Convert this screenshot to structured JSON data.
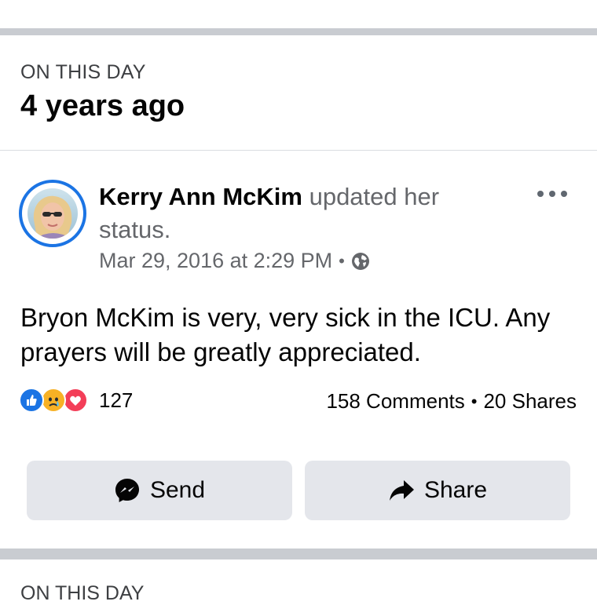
{
  "memory": {
    "label": "ON THIS DAY",
    "title": "4 years ago"
  },
  "post": {
    "author": "Kerry Ann McKim",
    "action": " updated her status.",
    "timestamp": "Mar 29, 2016 at 2:29 PM",
    "separator": "•",
    "privacy_icon": "globe-icon",
    "body": "Bryon McKim is very, very sick in the ICU. Any prayers will be greatly appreciated.",
    "reactions": {
      "types": [
        "like",
        "sad",
        "love"
      ],
      "count": "127"
    },
    "comments": "158 Comments",
    "shares": "20 Shares",
    "stats_separator": "•"
  },
  "actions": {
    "send_label": "Send",
    "share_label": "Share"
  },
  "next_memory": {
    "label": "ON THIS DAY"
  },
  "colors": {
    "accent": "#1b74e4",
    "secondary_text": "#65676b",
    "button_bg": "#e4e6eb",
    "divider": "#c9ccd1"
  }
}
